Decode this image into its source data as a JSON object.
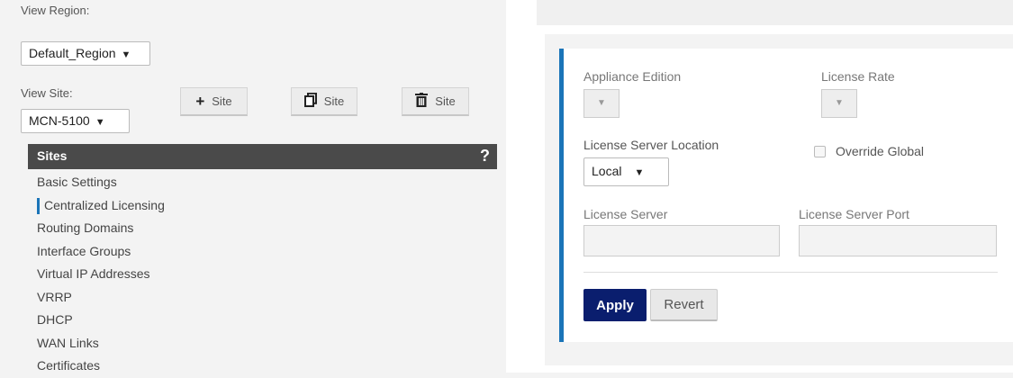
{
  "left": {
    "view_region_label": "View Region:",
    "view_region_value": "Default_Region",
    "view_site_label": "View Site:",
    "view_site_value": "MCN-5100",
    "buttons": {
      "add_site": "Site",
      "clone_site": "Site",
      "delete_site": "Site"
    },
    "sites_header": "Sites",
    "help": "?",
    "nav_items": [
      "Basic Settings",
      "Centralized Licensing",
      "Routing Domains",
      "Interface Groups",
      "Virtual IP Addresses",
      "VRRP",
      "DHCP",
      "WAN Links",
      "Certificates"
    ],
    "active_index": 1
  },
  "form": {
    "appliance_edition_label": "Appliance Edition",
    "license_rate_label": "License Rate",
    "license_server_location_label": "License Server Location",
    "license_server_location_value": "Local",
    "override_global_label": "Override Global",
    "license_server_label": "License Server",
    "license_server_value": "",
    "license_server_port_label": "License Server Port",
    "license_server_port_value": "",
    "apply_label": "Apply",
    "revert_label": "Revert"
  },
  "colors": {
    "accent": "#1a74b8",
    "apply_bg": "#0a1e6e",
    "header_bg": "#4a4a4a"
  }
}
